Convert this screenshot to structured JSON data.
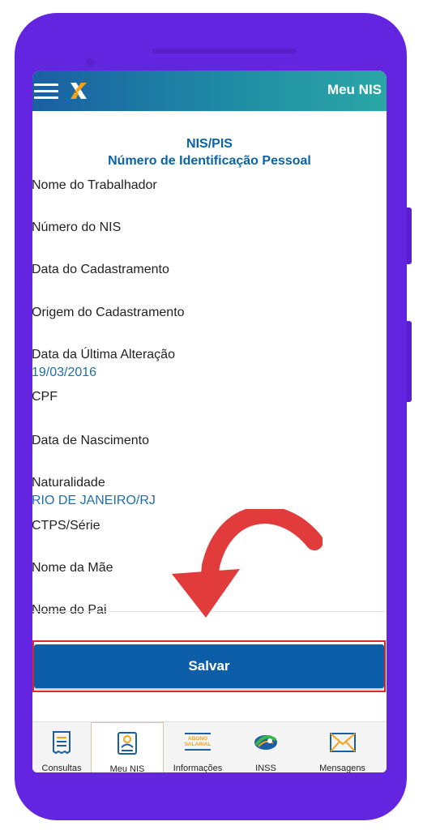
{
  "app": {
    "title": "Meu NIS"
  },
  "header": {
    "line1": "NIS/PIS",
    "line2": "Número de Identificação Pessoal"
  },
  "fields": [
    {
      "label": "Nome do Trabalhador",
      "value": ""
    },
    {
      "label": "Número do NIS",
      "value": ""
    },
    {
      "label": "Data do Cadastramento",
      "value": ""
    },
    {
      "label": "Origem do Cadastramento",
      "value": ""
    },
    {
      "label": "Data da Última Alteração",
      "value": "19/03/2016"
    },
    {
      "label": "CPF",
      "value": ""
    },
    {
      "label": "Data de Nascimento",
      "value": ""
    },
    {
      "label": "Naturalidade",
      "value": "RIO DE JANEIRO/RJ"
    },
    {
      "label": "CTPS/Série",
      "value": ""
    },
    {
      "label": "Nome da Mãe",
      "value": ""
    },
    {
      "label": "Nome do Pai",
      "value": ""
    }
  ],
  "actions": {
    "save_label": "Salvar"
  },
  "nav": [
    {
      "label": "Consultas",
      "icon": "document-list-icon",
      "active": false
    },
    {
      "label": "Meu NIS",
      "icon": "id-card-icon",
      "active": true
    },
    {
      "label": "Informações",
      "icon": "abono-salarial-icon",
      "active": false,
      "icon_text1": "ABONO",
      "icon_text2": "SALARIAL"
    },
    {
      "label": "INSS",
      "icon": "inss-logo-icon",
      "active": false
    },
    {
      "label": "Mensagens",
      "icon": "envelope-icon",
      "active": false
    }
  ],
  "colors": {
    "phone": "#6425e0",
    "appbar_start": "#1a5fa3",
    "appbar_end": "#2aa7a6",
    "accent": "#0c5ea8",
    "value_text": "#1e6fa8",
    "highlight": "#e02a2a"
  }
}
